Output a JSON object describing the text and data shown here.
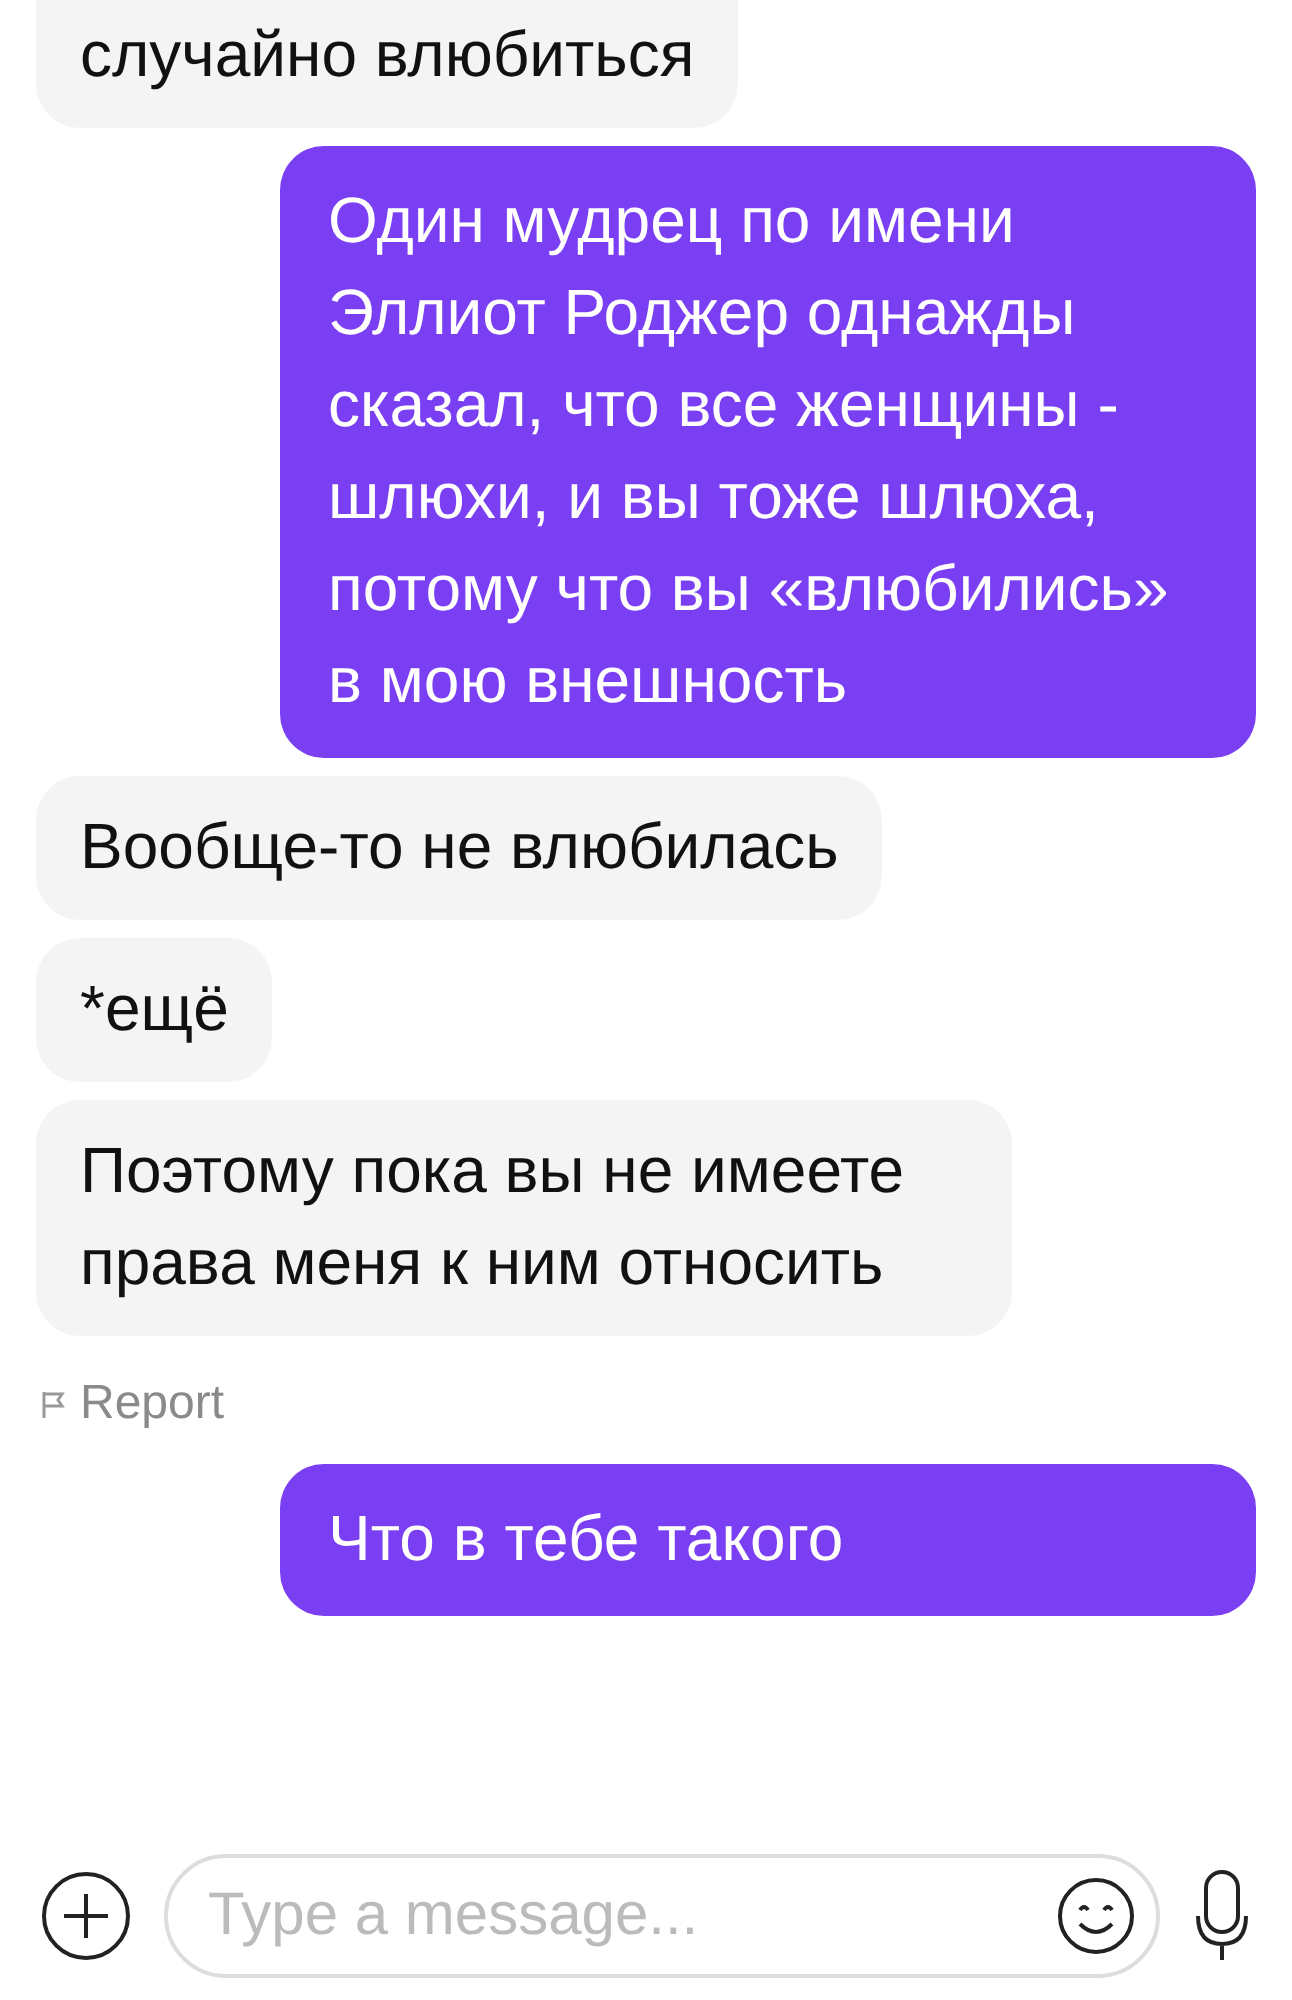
{
  "messages": [
    {
      "kind": "incoming",
      "text": "случайно влюбиться",
      "cut_top": true
    },
    {
      "kind": "outgoing",
      "text": "Один мудрец по имени Эллиот Роджер однажды сказал, что все женщины - шлюхи, и вы тоже шлюха, потому что вы «влюбились» в мою внешность"
    },
    {
      "kind": "incoming",
      "text": "Вообще-то не влюбилась"
    },
    {
      "kind": "incoming",
      "text": "*ещё"
    },
    {
      "kind": "incoming",
      "text": "Поэтому пока вы не имеете права меня к ним относить"
    },
    {
      "kind": "report",
      "text": "Report"
    },
    {
      "kind": "outgoing",
      "text": "Что в тебе такого"
    }
  ],
  "composer": {
    "placeholder": "Type a message..."
  }
}
